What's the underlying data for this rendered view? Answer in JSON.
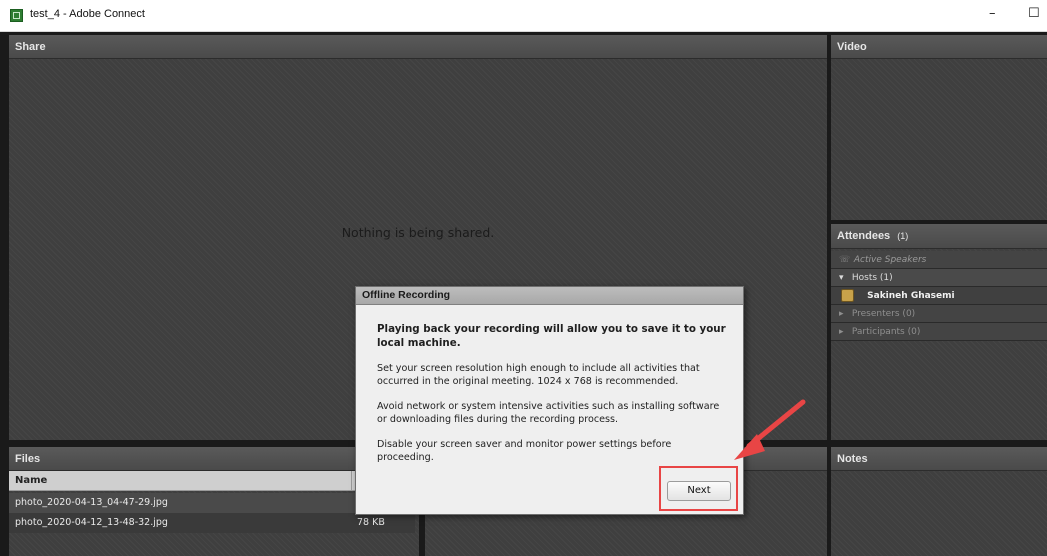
{
  "window": {
    "title": "test_4 - Adobe Connect",
    "minimize_glyph": "–",
    "maximize_glyph": "☐"
  },
  "share_pod": {
    "title": "Share",
    "message": "Nothing is being shared."
  },
  "video_pod": {
    "title": "Video"
  },
  "attendees_pod": {
    "title": "Attendees",
    "count": "(1)",
    "active_speakers": "Active Speakers",
    "groups": [
      {
        "label": "Hosts (1)",
        "expanded": true,
        "members": [
          "Sakineh Ghasemi"
        ]
      },
      {
        "label": "Presenters (0)",
        "expanded": false
      },
      {
        "label": "Participants (0)",
        "expanded": false
      }
    ]
  },
  "files_pod": {
    "title": "Files",
    "columns": [
      "Name",
      ""
    ],
    "rows": [
      {
        "name": "photo_2020-04-13_04-47-29.jpg",
        "size": ""
      },
      {
        "name": "photo_2020-04-12_13-48-32.jpg",
        "size": "78 KB"
      }
    ]
  },
  "notes_pod": {
    "title": "Notes"
  },
  "dialog": {
    "title": "Offline Recording",
    "heading": "Playing back your recording will allow you to save it to your local machine.",
    "paragraphs": [
      "Set your screen resolution high enough to include all activities that occurred in the original meeting. 1024 x 768 is recommended.",
      "Avoid network or system intensive activities such as installing software or downloading files during the recording process.",
      "Disable your screen saver and monitor power settings before proceeding."
    ],
    "next_label": "Next"
  },
  "colors": {
    "annotation": "#e84545",
    "pod_bg": "#3f3f3f",
    "pod_header": "#4a4a4a"
  }
}
